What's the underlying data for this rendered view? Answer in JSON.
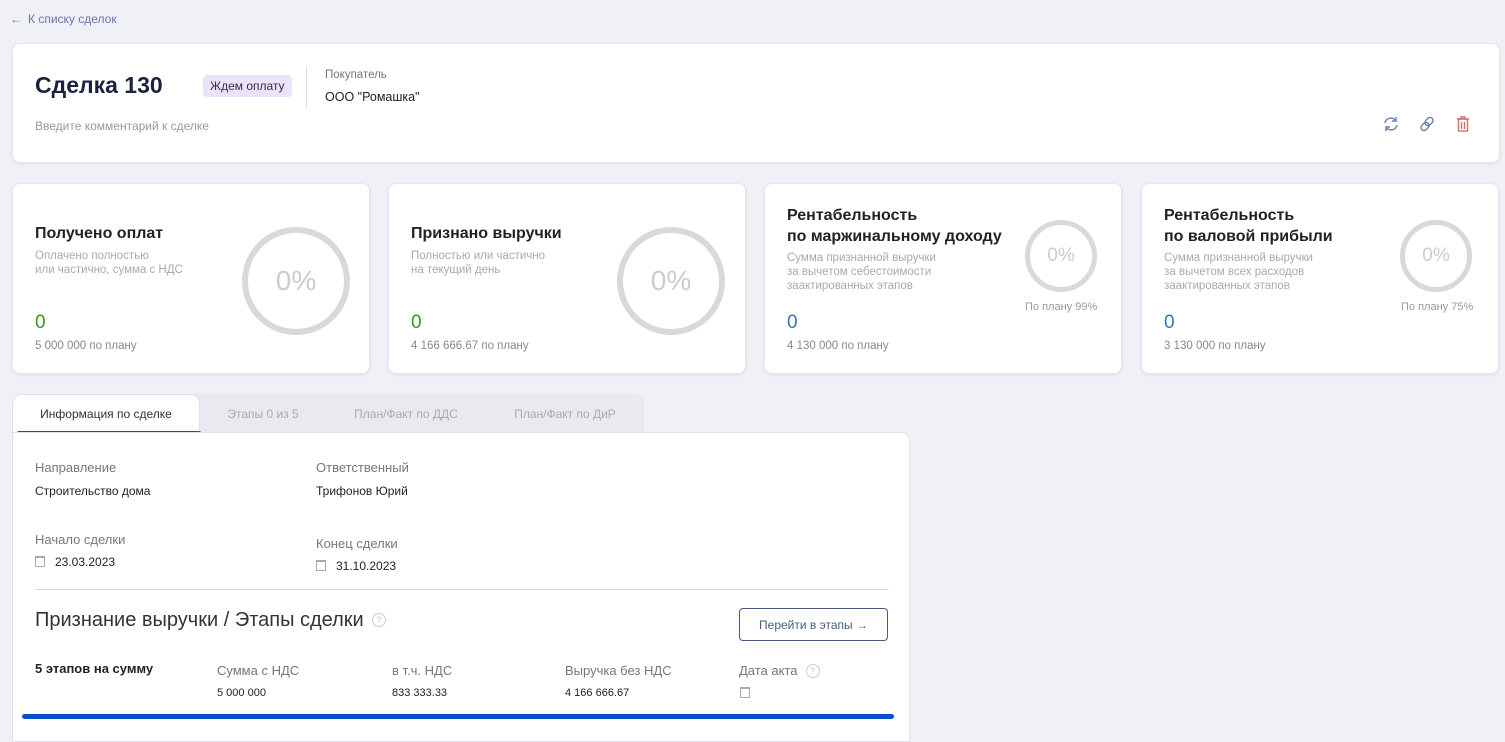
{
  "back_link": "К списку сделок",
  "deal": {
    "title": "Сделка 130",
    "status": "Ждем оплату",
    "buyer_label": "Покупатель",
    "buyer": "ООО \"Ромашка\"",
    "comment_placeholder": "Введите комментарий к сделке"
  },
  "stats": [
    {
      "title1": "Получено оплат",
      "title2": "",
      "sub1": "Оплачено полностью",
      "sub2": "или частично, сумма с НДС",
      "sub3": "",
      "value": "0",
      "plan": "5 000 000 по плану",
      "percent": "0%",
      "plan_pct": ""
    },
    {
      "title1": "Признано выручки",
      "title2": "",
      "sub1": "Полностью или частично",
      "sub2": "на текущий день",
      "sub3": "",
      "value": "0",
      "plan": "4 166 666.67 по плану",
      "percent": "0%",
      "plan_pct": ""
    },
    {
      "title1": "Рентабельность",
      "title2": "по маржинальному доходу",
      "sub1": "Сумма признанной выручки",
      "sub2": "за вычетом себестоимости",
      "sub3": "заактированных этапов",
      "value": "0",
      "plan": "4 130 000 по плану",
      "percent": "0%",
      "plan_pct": "По плану 99%"
    },
    {
      "title1": "Рентабельность",
      "title2": "по валовой прибыли",
      "sub1": "Сумма признанной выручки",
      "sub2": "за вычетом всех расходов",
      "sub3": "заактированных этапов",
      "value": "0",
      "plan": "3 130 000 по плану",
      "percent": "0%",
      "plan_pct": "По плану 75%"
    }
  ],
  "colors": {
    "green": "#3a9a1e",
    "blue": "#3a77b0",
    "accent": "#0b4fd0"
  },
  "tabs": [
    "Информация по сделке",
    "Этапы 0 из 5",
    "План/Факт по ДДС",
    "План/Факт по ДиР"
  ],
  "info": {
    "direction_label": "Направление",
    "direction": "Строительство дома",
    "responsible_label": "Ответственный",
    "responsible": "Трифонов Юрий",
    "start_label": "Начало сделки",
    "start": "23.03.2023",
    "end_label": "Конец сделки",
    "end": "31.10.2023"
  },
  "revenue": {
    "title": "Признание выручки / Этапы сделки",
    "button": "Перейти в этапы →",
    "summary": "5 этапов на сумму",
    "cols": [
      {
        "label": "Сумма с НДС",
        "value": "5 000 000"
      },
      {
        "label": "в т.ч. НДС",
        "value": "833 333.33"
      },
      {
        "label": "Выручка без НДС",
        "value": "4 166 666.67"
      },
      {
        "label": "Дата акта",
        "value": ""
      }
    ]
  }
}
